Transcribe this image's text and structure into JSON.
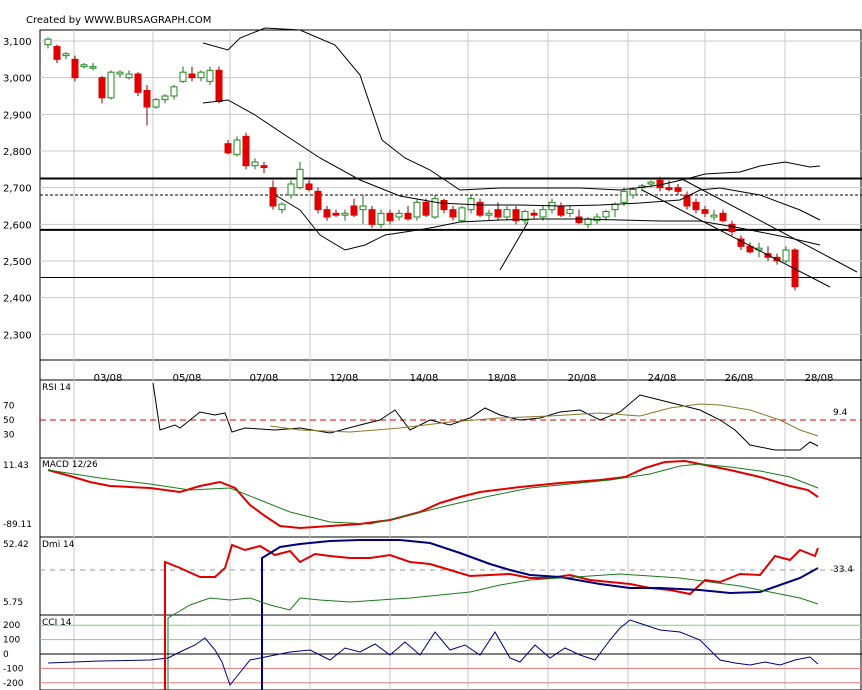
{
  "header": {
    "credit": "Created by WWW.BURSAGRAPH.COM"
  },
  "colors": {
    "up": "#1a8a1a",
    "down": "#e00000",
    "grid": "#c8c8c8",
    "signal_red": "#e00000",
    "navy": "#00007a",
    "olive": "#8a7a2a"
  },
  "chart_data": [
    {
      "type": "candlestick",
      "name": "price",
      "y_ticks": [
        "3,100",
        "3,000",
        "2,900",
        "2,800",
        "2,700",
        "2,600",
        "2,500",
        "2,400",
        "2,300"
      ],
      "y_tick_values": [
        3100,
        3000,
        2900,
        2800,
        2700,
        2600,
        2500,
        2400,
        2300
      ],
      "ylim": [
        2230,
        3130
      ],
      "x_tick_labels": [
        "03/08",
        "05/08",
        "07/08",
        "12/08",
        "14/08",
        "18/08",
        "20/08",
        "24/08",
        "26/08",
        "28/08"
      ],
      "grid": true,
      "horizontal_levels": [
        2725,
        2680,
        2585,
        2455
      ],
      "ohlc": [
        [
          3090,
          3110,
          3080,
          3105
        ],
        [
          3085,
          3090,
          3040,
          3050
        ],
        [
          3060,
          3070,
          3050,
          3065
        ],
        [
          3050,
          3060,
          2990,
          3000
        ],
        [
          3030,
          3040,
          3025,
          3035
        ],
        [
          3030,
          3040,
          3020,
          3030
        ],
        [
          3000,
          3005,
          2930,
          2945
        ],
        [
          2945,
          3020,
          2940,
          3015
        ],
        [
          3010,
          3020,
          3000,
          3015
        ],
        [
          3000,
          3020,
          2995,
          3010
        ],
        [
          3010,
          3015,
          2950,
          2960
        ],
        [
          2965,
          2980,
          2870,
          2920
        ],
        [
          2920,
          2945,
          2915,
          2940
        ],
        [
          2940,
          2955,
          2930,
          2950
        ],
        [
          2950,
          2980,
          2940,
          2975
        ],
        [
          2990,
          3030,
          2985,
          3015
        ],
        [
          3010,
          3030,
          2990,
          3000
        ],
        [
          3000,
          3020,
          2990,
          3015
        ],
        [
          2990,
          3030,
          2980,
          3020
        ],
        [
          3020,
          3030,
          2930,
          2935
        ],
        [
          2820,
          2830,
          2790,
          2795
        ],
        [
          2790,
          2840,
          2785,
          2830
        ],
        [
          2840,
          2850,
          2750,
          2760
        ],
        [
          2760,
          2780,
          2750,
          2770
        ],
        [
          2760,
          2770,
          2740,
          2755
        ],
        [
          2700,
          2720,
          2640,
          2650
        ],
        [
          2640,
          2660,
          2630,
          2655
        ],
        [
          2680,
          2720,
          2670,
          2710
        ],
        [
          2700,
          2770,
          2695,
          2750
        ],
        [
          2710,
          2720,
          2690,
          2695
        ],
        [
          2690,
          2700,
          2630,
          2640
        ],
        [
          2640,
          2650,
          2610,
          2620
        ],
        [
          2630,
          2640,
          2620,
          2625
        ],
        [
          2625,
          2640,
          2610,
          2630
        ],
        [
          2650,
          2670,
          2620,
          2625
        ],
        [
          2640,
          2680,
          2600,
          2650
        ],
        [
          2640,
          2650,
          2590,
          2600
        ],
        [
          2600,
          2640,
          2590,
          2630
        ],
        [
          2630,
          2640,
          2600,
          2610
        ],
        [
          2620,
          2640,
          2610,
          2630
        ],
        [
          2630,
          2650,
          2610,
          2615
        ],
        [
          2620,
          2670,
          2610,
          2660
        ],
        [
          2660,
          2670,
          2620,
          2625
        ],
        [
          2620,
          2680,
          2615,
          2670
        ],
        [
          2665,
          2670,
          2630,
          2640
        ],
        [
          2640,
          2650,
          2610,
          2620
        ],
        [
          2610,
          2650,
          2605,
          2645
        ],
        [
          2640,
          2680,
          2630,
          2670
        ],
        [
          2660,
          2670,
          2620,
          2625
        ],
        [
          2625,
          2640,
          2610,
          2630
        ],
        [
          2640,
          2660,
          2610,
          2620
        ],
        [
          2620,
          2650,
          2610,
          2640
        ],
        [
          2640,
          2650,
          2600,
          2610
        ],
        [
          2610,
          2640,
          2600,
          2635
        ],
        [
          2630,
          2640,
          2615,
          2625
        ],
        [
          2620,
          2650,
          2610,
          2640
        ],
        [
          2640,
          2670,
          2630,
          2660
        ],
        [
          2650,
          2660,
          2620,
          2625
        ],
        [
          2630,
          2650,
          2620,
          2640
        ],
        [
          2620,
          2640,
          2600,
          2605
        ],
        [
          2600,
          2620,
          2590,
          2615
        ],
        [
          2610,
          2630,
          2600,
          2620
        ],
        [
          2620,
          2640,
          2610,
          2635
        ],
        [
          2640,
          2660,
          2620,
          2655
        ],
        [
          2660,
          2700,
          2650,
          2690
        ],
        [
          2680,
          2700,
          2670,
          2695
        ],
        [
          2700,
          2710,
          2690,
          2705
        ],
        [
          2710,
          2720,
          2700,
          2715
        ],
        [
          2720,
          2730,
          2690,
          2700
        ],
        [
          2700,
          2720,
          2690,
          2695
        ],
        [
          2700,
          2710,
          2680,
          2690
        ],
        [
          2680,
          2690,
          2640,
          2650
        ],
        [
          2660,
          2670,
          2630,
          2640
        ],
        [
          2640,
          2650,
          2620,
          2630
        ],
        [
          2620,
          2640,
          2610,
          2625
        ],
        [
          2630,
          2640,
          2605,
          2610
        ],
        [
          2600,
          2610,
          2570,
          2580
        ],
        [
          2560,
          2570,
          2530,
          2540
        ],
        [
          2540,
          2550,
          2520,
          2525
        ],
        [
          2530,
          2550,
          2510,
          2535
        ],
        [
          2520,
          2540,
          2500,
          2510
        ],
        [
          2510,
          2520,
          2490,
          2500
        ],
        [
          2500,
          2540,
          2495,
          2530
        ],
        [
          2530,
          2535,
          2420,
          2430
        ]
      ]
    },
    {
      "type": "line",
      "name": "rsi",
      "label": "RSI 14",
      "y_ticks": [
        "70",
        "50",
        "30"
      ],
      "y_tick_values": [
        70,
        50,
        30
      ],
      "ylim": [
        0,
        100
      ],
      "last_value_label": "9.4"
    },
    {
      "type": "line",
      "name": "macd",
      "label": "MACD 12/26",
      "y_ticks": [
        "11.43",
        "-89.11"
      ],
      "ylim": [
        -89.11,
        11.43
      ]
    },
    {
      "type": "line",
      "name": "dmi",
      "label": "Dmi 14",
      "y_ticks": [
        "52.42",
        "5.75"
      ],
      "ylim": [
        5.75,
        52.42
      ],
      "last_value_label": "33.4"
    },
    {
      "type": "line",
      "name": "cci",
      "label": "CCI 14",
      "y_ticks": [
        "200",
        "100",
        "0",
        "-100",
        "-200"
      ],
      "y_tick_values": [
        200,
        100,
        0,
        -100,
        -200
      ],
      "ylim": [
        -250,
        250
      ]
    }
  ]
}
